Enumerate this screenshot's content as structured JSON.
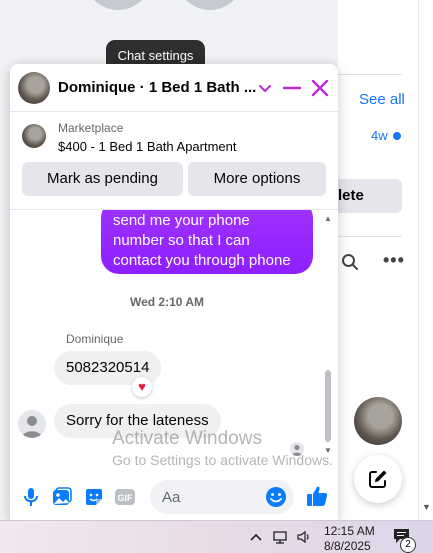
{
  "tooltip": {
    "text": "Chat settings"
  },
  "chat": {
    "title": "Dominique · 1 Bed 1 Bath ...",
    "listing": {
      "category": "Marketplace",
      "name": "$400 - 1 Bed 1 Bath Apartment",
      "mark_pending_label": "Mark as pending",
      "more_options_label": "More options"
    },
    "messages": {
      "outgoing_text": "send me your phone number so that I can contact you through phone",
      "timestamp": "Wed 2:10 AM",
      "sender": "Dominique",
      "incoming": [
        {
          "text": "5082320514",
          "reaction": "♥"
        },
        {
          "text": "Sorry for the lateness"
        }
      ]
    },
    "composer": {
      "placeholder": "Aa"
    }
  },
  "background": {
    "see_all": "See all",
    "time_ago": "4w",
    "delete_label": "lete"
  },
  "watermark": {
    "line1": "Activate Windows",
    "line2": "Go to Settings to activate Windows."
  },
  "taskbar": {
    "time": "12:15 AM",
    "date": "8/8/2025",
    "notification_count": "2"
  },
  "colors": {
    "accent": "#1877f2",
    "messenger_purple": "#a033ff",
    "close": "#bc2bd9"
  },
  "icons": [
    "chevron-down-icon",
    "minimize-icon",
    "close-icon",
    "mic-icon",
    "photo-icon",
    "sticker-icon",
    "gif-icon",
    "emoji-icon",
    "like-icon",
    "compose-icon",
    "search-icon",
    "more-icon"
  ]
}
